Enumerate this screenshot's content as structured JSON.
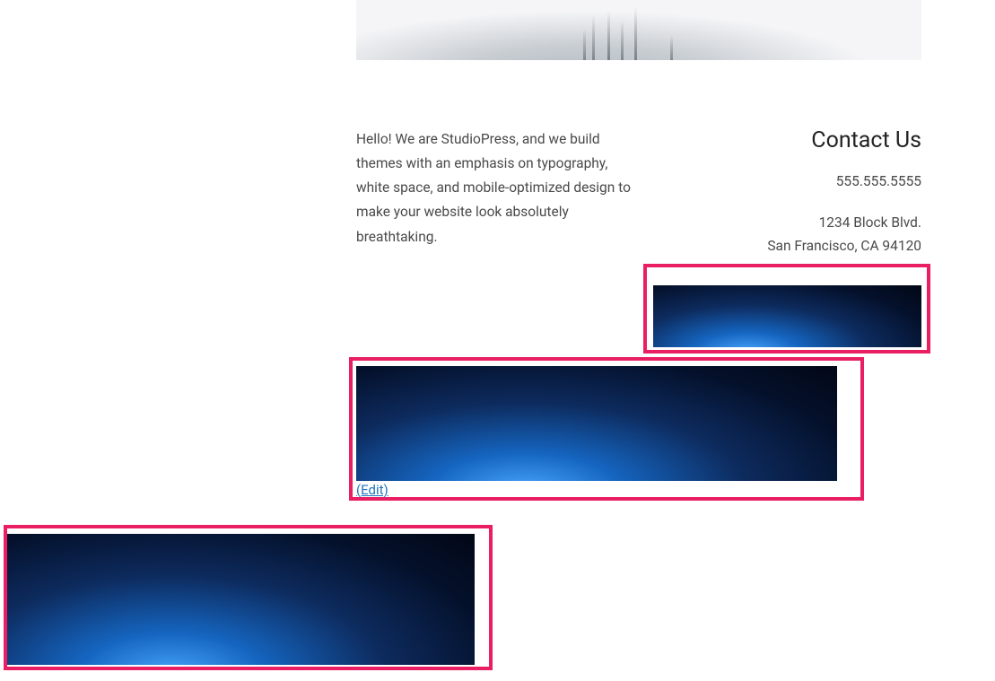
{
  "intro": {
    "text": "Hello! We are StudioPress, and we build themes with an emphasis on typography, white space, and mobile-optimized design to make your website look absolutely breathtaking."
  },
  "contact": {
    "title": "Contact Us",
    "phone": "555.555.5555",
    "address_line1": "1234 Block Blvd.",
    "address_line2": "San Francisco, CA 94120"
  },
  "edit": {
    "label": "(Edit)"
  },
  "colors": {
    "highlight": "#e91e63",
    "link": "#1e73be",
    "text": "#4a4a4a"
  }
}
